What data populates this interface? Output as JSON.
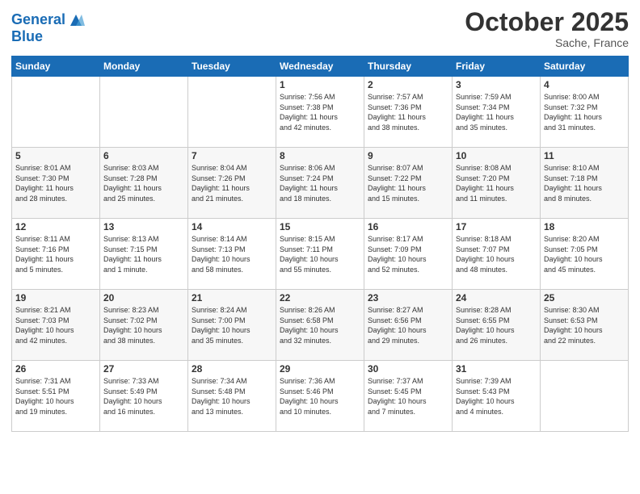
{
  "logo": {
    "line1": "General",
    "line2": "Blue"
  },
  "title": "October 2025",
  "location": "Sache, France",
  "days_header": [
    "Sunday",
    "Monday",
    "Tuesday",
    "Wednesday",
    "Thursday",
    "Friday",
    "Saturday"
  ],
  "weeks": [
    [
      {
        "day": "",
        "info": ""
      },
      {
        "day": "",
        "info": ""
      },
      {
        "day": "",
        "info": ""
      },
      {
        "day": "1",
        "info": "Sunrise: 7:56 AM\nSunset: 7:38 PM\nDaylight: 11 hours\nand 42 minutes."
      },
      {
        "day": "2",
        "info": "Sunrise: 7:57 AM\nSunset: 7:36 PM\nDaylight: 11 hours\nand 38 minutes."
      },
      {
        "day": "3",
        "info": "Sunrise: 7:59 AM\nSunset: 7:34 PM\nDaylight: 11 hours\nand 35 minutes."
      },
      {
        "day": "4",
        "info": "Sunrise: 8:00 AM\nSunset: 7:32 PM\nDaylight: 11 hours\nand 31 minutes."
      }
    ],
    [
      {
        "day": "5",
        "info": "Sunrise: 8:01 AM\nSunset: 7:30 PM\nDaylight: 11 hours\nand 28 minutes."
      },
      {
        "day": "6",
        "info": "Sunrise: 8:03 AM\nSunset: 7:28 PM\nDaylight: 11 hours\nand 25 minutes."
      },
      {
        "day": "7",
        "info": "Sunrise: 8:04 AM\nSunset: 7:26 PM\nDaylight: 11 hours\nand 21 minutes."
      },
      {
        "day": "8",
        "info": "Sunrise: 8:06 AM\nSunset: 7:24 PM\nDaylight: 11 hours\nand 18 minutes."
      },
      {
        "day": "9",
        "info": "Sunrise: 8:07 AM\nSunset: 7:22 PM\nDaylight: 11 hours\nand 15 minutes."
      },
      {
        "day": "10",
        "info": "Sunrise: 8:08 AM\nSunset: 7:20 PM\nDaylight: 11 hours\nand 11 minutes."
      },
      {
        "day": "11",
        "info": "Sunrise: 8:10 AM\nSunset: 7:18 PM\nDaylight: 11 hours\nand 8 minutes."
      }
    ],
    [
      {
        "day": "12",
        "info": "Sunrise: 8:11 AM\nSunset: 7:16 PM\nDaylight: 11 hours\nand 5 minutes."
      },
      {
        "day": "13",
        "info": "Sunrise: 8:13 AM\nSunset: 7:15 PM\nDaylight: 11 hours\nand 1 minute."
      },
      {
        "day": "14",
        "info": "Sunrise: 8:14 AM\nSunset: 7:13 PM\nDaylight: 10 hours\nand 58 minutes."
      },
      {
        "day": "15",
        "info": "Sunrise: 8:15 AM\nSunset: 7:11 PM\nDaylight: 10 hours\nand 55 minutes."
      },
      {
        "day": "16",
        "info": "Sunrise: 8:17 AM\nSunset: 7:09 PM\nDaylight: 10 hours\nand 52 minutes."
      },
      {
        "day": "17",
        "info": "Sunrise: 8:18 AM\nSunset: 7:07 PM\nDaylight: 10 hours\nand 48 minutes."
      },
      {
        "day": "18",
        "info": "Sunrise: 8:20 AM\nSunset: 7:05 PM\nDaylight: 10 hours\nand 45 minutes."
      }
    ],
    [
      {
        "day": "19",
        "info": "Sunrise: 8:21 AM\nSunset: 7:03 PM\nDaylight: 10 hours\nand 42 minutes."
      },
      {
        "day": "20",
        "info": "Sunrise: 8:23 AM\nSunset: 7:02 PM\nDaylight: 10 hours\nand 38 minutes."
      },
      {
        "day": "21",
        "info": "Sunrise: 8:24 AM\nSunset: 7:00 PM\nDaylight: 10 hours\nand 35 minutes."
      },
      {
        "day": "22",
        "info": "Sunrise: 8:26 AM\nSunset: 6:58 PM\nDaylight: 10 hours\nand 32 minutes."
      },
      {
        "day": "23",
        "info": "Sunrise: 8:27 AM\nSunset: 6:56 PM\nDaylight: 10 hours\nand 29 minutes."
      },
      {
        "day": "24",
        "info": "Sunrise: 8:28 AM\nSunset: 6:55 PM\nDaylight: 10 hours\nand 26 minutes."
      },
      {
        "day": "25",
        "info": "Sunrise: 8:30 AM\nSunset: 6:53 PM\nDaylight: 10 hours\nand 22 minutes."
      }
    ],
    [
      {
        "day": "26",
        "info": "Sunrise: 7:31 AM\nSunset: 5:51 PM\nDaylight: 10 hours\nand 19 minutes."
      },
      {
        "day": "27",
        "info": "Sunrise: 7:33 AM\nSunset: 5:49 PM\nDaylight: 10 hours\nand 16 minutes."
      },
      {
        "day": "28",
        "info": "Sunrise: 7:34 AM\nSunset: 5:48 PM\nDaylight: 10 hours\nand 13 minutes."
      },
      {
        "day": "29",
        "info": "Sunrise: 7:36 AM\nSunset: 5:46 PM\nDaylight: 10 hours\nand 10 minutes."
      },
      {
        "day": "30",
        "info": "Sunrise: 7:37 AM\nSunset: 5:45 PM\nDaylight: 10 hours\nand 7 minutes."
      },
      {
        "day": "31",
        "info": "Sunrise: 7:39 AM\nSunset: 5:43 PM\nDaylight: 10 hours\nand 4 minutes."
      },
      {
        "day": "",
        "info": ""
      }
    ]
  ]
}
